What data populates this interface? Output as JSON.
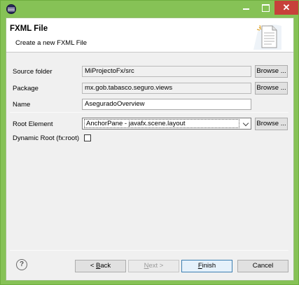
{
  "titlebar": {
    "close_glyph": "✕"
  },
  "header": {
    "title": "FXML File",
    "subtitle": "Create a new FXML File"
  },
  "form": {
    "source_folder": {
      "label": "Source folder",
      "value": "MiProjectoFx/src",
      "browse": "Browse ..."
    },
    "package": {
      "label": "Package",
      "value": "mx.gob.tabasco.seguro.views",
      "browse": "Browse ..."
    },
    "name": {
      "label": "Name",
      "value": "AseguradoOverview"
    },
    "root_element": {
      "label": "Root Element",
      "value": "AnchorPane - javafx.scene.layout",
      "browse": "Browse ..."
    },
    "dynamic_root": {
      "label": "Dynamic Root (fx:root)",
      "checked": false
    }
  },
  "footer": {
    "help_glyph": "?",
    "back_mn": "B",
    "back_rest": "ack",
    "back_prefix": "< ",
    "next_mn": "N",
    "next_rest": "ext >",
    "finish_mn": "F",
    "finish_rest": "inish",
    "cancel": "Cancel"
  }
}
